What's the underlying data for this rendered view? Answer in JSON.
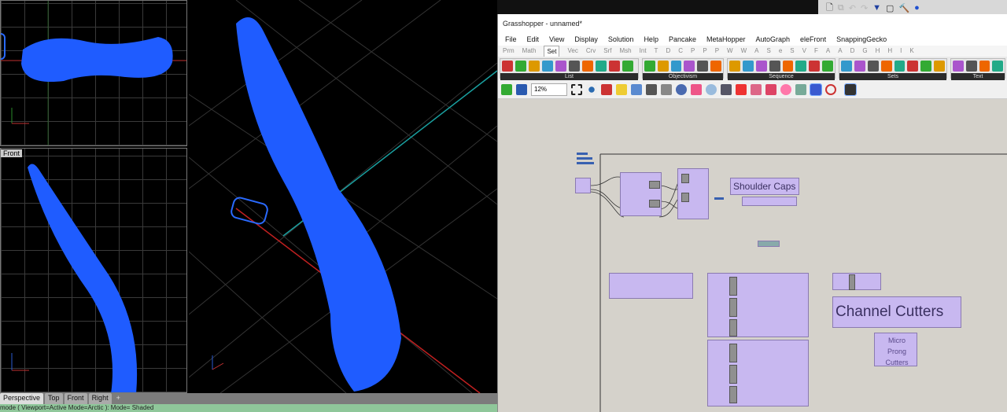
{
  "rhino": {
    "viewports": {
      "front_label": "Front"
    },
    "viewport_tabs": [
      "Perspective",
      "Top",
      "Front",
      "Right",
      "+"
    ],
    "command_line": "mode ( Viewport=Active  Mode=Arctic ):  Mode= Shaded"
  },
  "grasshopper": {
    "title": "Grasshopper - unnamed*",
    "menu": [
      "File",
      "Edit",
      "View",
      "Display",
      "Solution",
      "Help",
      "Pancake",
      "MetaHopper",
      "AutoGraph",
      "eleFront",
      "SnappingGecko"
    ],
    "tabs": [
      "Prm",
      "Math",
      "Set",
      "Vec",
      "Crv",
      "Srf",
      "Msh",
      "Int",
      "T",
      "D",
      "C",
      "P",
      "P",
      "P",
      "W",
      "W",
      "A",
      "S",
      "e",
      "S",
      "V",
      "F",
      "A",
      "A",
      "D",
      "G",
      "H",
      "H",
      "I",
      "K"
    ],
    "active_tab": "Set",
    "panels": [
      "List",
      "Objectivism",
      "Sequence",
      "Sets",
      "Text"
    ],
    "zoom": "12%",
    "groups": {
      "shoulder": "Shoulder Caps",
      "channel": "Channel Cutters",
      "micro": "Micro Prong Cutters"
    }
  },
  "colors": {
    "mesh": "#1f5cff",
    "group": "#c8b8f0",
    "canvas": "#d5d2cb"
  }
}
